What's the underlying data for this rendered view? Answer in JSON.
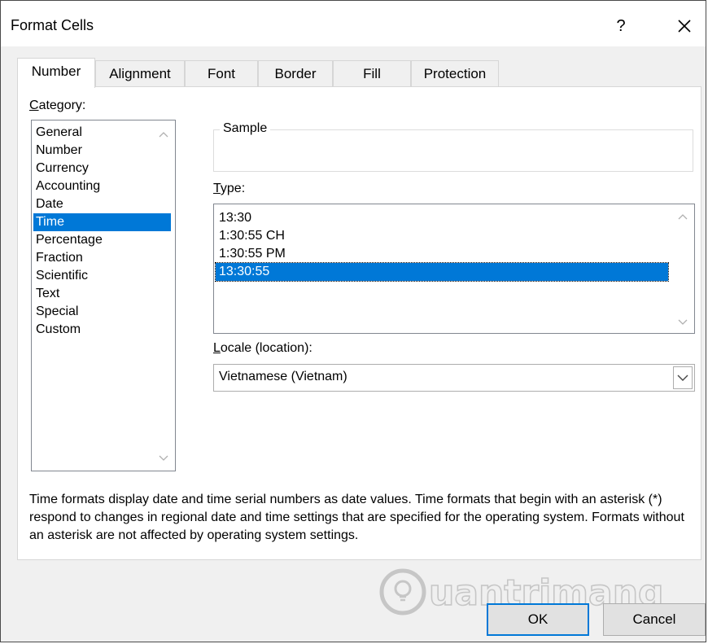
{
  "window": {
    "title": "Format Cells",
    "help_label": "?"
  },
  "tabs": [
    {
      "label": "Number"
    },
    {
      "label": "Alignment"
    },
    {
      "label": "Font"
    },
    {
      "label": "Border"
    },
    {
      "label": "Fill"
    },
    {
      "label": "Protection"
    }
  ],
  "category": {
    "label_prefix": "C",
    "label_rest": "ategory:",
    "items": [
      "General",
      "Number",
      "Currency",
      "Accounting",
      "Date",
      "Time",
      "Percentage",
      "Fraction",
      "Scientific",
      "Text",
      "Special",
      "Custom"
    ],
    "selected": "Time"
  },
  "sample": {
    "label": "Sample",
    "value": ""
  },
  "type": {
    "label_prefix": "T",
    "label_rest": "ype:",
    "items": [
      "13:30",
      "1:30:55 CH",
      "1:30:55 PM",
      "13:30:55"
    ],
    "selected": "13:30:55"
  },
  "locale": {
    "label_prefix": "L",
    "label_rest": "ocale (location):",
    "value": "Vietnamese (Vietnam)"
  },
  "description": "Time formats display date and time serial numbers as date values.  Time formats that begin with an asterisk (*) respond to changes in regional date and time settings that are specified for the operating system. Formats without an asterisk are not affected by operating system settings.",
  "buttons": {
    "ok": "OK",
    "cancel": "Cancel"
  },
  "watermark": {
    "text": "uantrimang"
  },
  "colors": {
    "selection": "#0078d7",
    "dialog_bg": "#f0f0f0"
  }
}
